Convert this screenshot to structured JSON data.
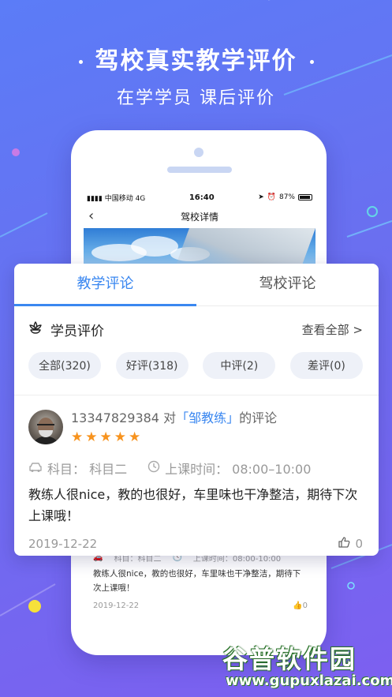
{
  "promo": {
    "headline": "驾校真实教学评价",
    "subline": "在学学员 课后评价"
  },
  "phone": {
    "statusbar": {
      "carrier": "中国移动",
      "network": "4G",
      "time": "16:40",
      "battery": "87%"
    },
    "navbar": {
      "title": "驾校详情",
      "back_icon": "chevron-left-icon"
    },
    "mini_review": {
      "subject": "科目：科目二",
      "time": "上课时间：08:00-10:00",
      "text": "教练人很nice，教的也很好，车里味也干净整洁，期待下次上课哦！",
      "date": "2019-12-22",
      "likes": "0"
    }
  },
  "card": {
    "tabs": [
      {
        "label": "教学评论",
        "active": true
      },
      {
        "label": "驾校评论",
        "active": false
      }
    ],
    "section_title": "学员评价",
    "see_all": "查看全部 >",
    "filters": [
      {
        "label": "全部(320)"
      },
      {
        "label": "好评(318)"
      },
      {
        "label": "中评(2)"
      },
      {
        "label": "差评(0)"
      }
    ],
    "review": {
      "phone_number": "13347829384",
      "to": "对",
      "coach": "「邹教练」",
      "suffix": "的评论",
      "stars": 5,
      "subject": "科目：  科目二",
      "time": "上课时间：  08:00–10:00",
      "text": "教练人很nice，教的也很好，车里味也干净整洁，期待下次上课哦！",
      "date": "2019-12-22",
      "likes": "0"
    }
  },
  "watermark": {
    "cn": "谷普软件园",
    "url": "www.gupuxlazai.com"
  },
  "colors": {
    "accent": "#3a87f0",
    "star": "#f7931e",
    "bg_start": "#5b7cf7",
    "bg_end": "#7d5ff0"
  }
}
